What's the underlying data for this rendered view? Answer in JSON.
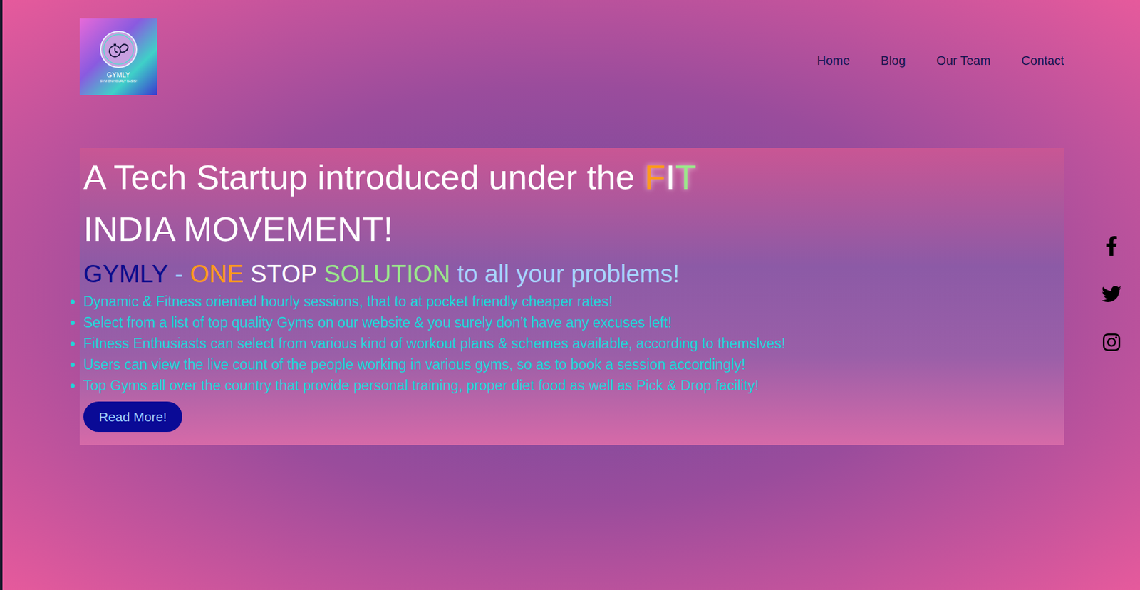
{
  "logo": {
    "name": "GYMLY",
    "tagline": "GYM ON HOURLY BASIS!"
  },
  "nav": [
    {
      "label": "Home"
    },
    {
      "label": "Blog"
    },
    {
      "label": "Our Team"
    },
    {
      "label": "Contact"
    }
  ],
  "hero": {
    "heading": {
      "prefix": "A Tech Startup introduced under the",
      "highlight": [
        {
          "text": "F",
          "color": "#ff9a1a"
        },
        {
          "text": "I",
          "color": "#ffffff"
        },
        {
          "text": "T",
          "color": "#9be88a"
        }
      ],
      "suffix": "INDIA MOVEMENT!"
    },
    "subtitle": [
      {
        "text": "GYMLY",
        "color": "#0c0c8c"
      },
      {
        "text": "-",
        "color": "#9fd0ff"
      },
      {
        "text": "ONE",
        "color": "#ff9a1a"
      },
      {
        "text": "STOP",
        "color": "#ffffff"
      },
      {
        "text": "SOLUTION",
        "color": "#9be88a"
      },
      {
        "text": "to all your problems!",
        "color": "#a8d4ff"
      }
    ],
    "bullets": [
      "Dynamic & Fitness oriented hourly sessions, that to at pocket friendly cheaper rates!",
      "Select from a list of top quality Gyms on our website & you surely don’t have any excuses left!",
      "Fitness Enthusiasts can select from various kind of workout plans & schemes available, according to themslves!",
      "Users can view the live count of the people working in various gyms, so as to book a session accordingly!",
      "Top Gyms all over the country that provide personal training, proper diet food as well as Pick & Drop facility!"
    ],
    "button": "Read More!"
  }
}
